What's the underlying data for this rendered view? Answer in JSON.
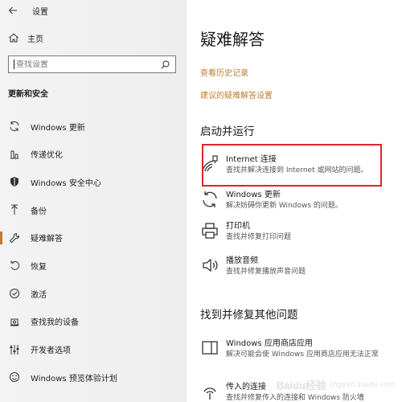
{
  "window": {
    "title": "设置"
  },
  "sidebar": {
    "home": {
      "label": "主页",
      "icon": "home-icon"
    },
    "search": {
      "placeholder": "查找设置"
    },
    "section_header": "更新和安全",
    "items": [
      {
        "label": "Windows 更新",
        "icon": "sync-icon"
      },
      {
        "label": "传递优化",
        "icon": "delivery-optimization-icon"
      },
      {
        "label": "Windows 安全中心",
        "icon": "shield-icon"
      },
      {
        "label": "备份",
        "icon": "backup-arrow-icon"
      },
      {
        "label": "疑难解答",
        "icon": "wrench-icon",
        "active": true
      },
      {
        "label": "恢复",
        "icon": "recovery-icon"
      },
      {
        "label": "激活",
        "icon": "activation-check-icon"
      },
      {
        "label": "查找我的设备",
        "icon": "find-device-icon"
      },
      {
        "label": "开发者选项",
        "icon": "developer-icon"
      },
      {
        "label": "Windows 预览体验计划",
        "icon": "insider-smiley-icon"
      }
    ]
  },
  "main": {
    "title": "疑难解答",
    "links": {
      "history": "查看历史记录",
      "recommended": "建议的疑难解答设置"
    },
    "group1": {
      "title": "启动并运行",
      "items": [
        {
          "name": "Internet 连接",
          "desc": "查找并解决连接到 Internet 或网站的问题。",
          "icon": "network-icon"
        },
        {
          "name": "Windows 更新",
          "desc": "解决妨碍你更新 Windows 的问题。",
          "icon": "sync-icon"
        },
        {
          "name": "打印机",
          "desc": "查找并修复打印问题",
          "icon": "printer-icon"
        },
        {
          "name": "播放音频",
          "desc": "查找并修复播放声音问题",
          "icon": "speaker-icon"
        }
      ]
    },
    "group2": {
      "title": "找到并修复其他问题",
      "items": [
        {
          "name": "Windows 应用商店应用",
          "desc": "解决可能会使 Windows 应用商店应用无法正常",
          "icon": "store-app-icon"
        },
        {
          "name": "传入的连接",
          "desc": "查找并修复传入的连接和 Windows 防火墙",
          "icon": "incoming-connection-icon"
        }
      ]
    }
  },
  "watermark": {
    "text": "Baidu经验",
    "sub": "jingyan.baidu.com"
  },
  "colors": {
    "accent": "#c07d2e",
    "highlight": "#d9262c"
  }
}
